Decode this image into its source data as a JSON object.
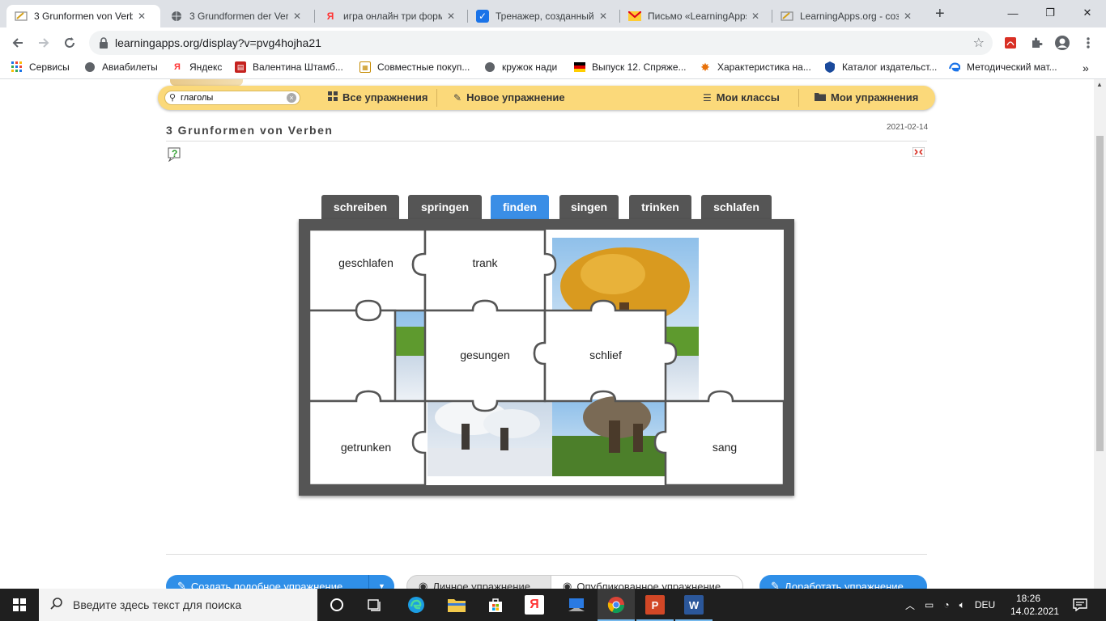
{
  "browser": {
    "tabs": [
      {
        "title": "3 Grunformen von Verb",
        "active": true,
        "icon": "learningapps-icon"
      },
      {
        "title": "3 Grundformen der Ver",
        "active": false,
        "icon": "globe-icon"
      },
      {
        "title": "игра онлайн три форм",
        "active": false,
        "icon": "yandex-icon"
      },
      {
        "title": "Тренажер, созданный",
        "active": false,
        "icon": "check-icon"
      },
      {
        "title": "Письмо «LearningApps",
        "active": false,
        "icon": "mail-icon"
      },
      {
        "title": "LearningApps.org - соз",
        "active": false,
        "icon": "learningapps-icon"
      }
    ],
    "url": "learningapps.org/display?v=pvg4hojha21",
    "bookmarks": [
      {
        "label": "Сервисы",
        "icon": "apps-grid-icon"
      },
      {
        "label": "Авиабилеты",
        "icon": "globe-icon"
      },
      {
        "label": "Яндекс",
        "icon": "yandex-icon"
      },
      {
        "label": "Валентина Штамб...",
        "icon": "book-icon"
      },
      {
        "label": "Совместные покуп...",
        "icon": "calendar-icon"
      },
      {
        "label": "кружок нади",
        "icon": "globe-icon"
      },
      {
        "label": "Выпуск 12. Спряже...",
        "icon": "german-flag-icon"
      },
      {
        "label": "Характеристика на...",
        "icon": "star-icon"
      },
      {
        "label": "Каталог издательст...",
        "icon": "shield-icon"
      },
      {
        "label": "Методический мат...",
        "icon": "edge-icon"
      }
    ]
  },
  "la_nav": {
    "search_value": "глаголы",
    "all_exercises": "Все упражнения",
    "new_exercise": "Новое упражнение",
    "my_classes": "Мои классы",
    "my_exercises": "Мои упражнения"
  },
  "app": {
    "title": "3 Grunformen von Verben",
    "date": "2021-02-14",
    "verb_tabs": [
      {
        "label": "schreiben",
        "selected": false
      },
      {
        "label": "springen",
        "selected": false
      },
      {
        "label": "finden",
        "selected": true
      },
      {
        "label": "singen",
        "selected": false
      },
      {
        "label": "trinken",
        "selected": false
      },
      {
        "label": "schlafen",
        "selected": false
      }
    ],
    "pieces": [
      "geschlafen",
      "trank",
      "gesungen",
      "schlief",
      "getrunken",
      "sang"
    ]
  },
  "bottom_buttons": {
    "create_similar": "Создать подобное упражнение",
    "private": "Личное упражнение",
    "published": "Опубликованное упражнение",
    "improve": "Доработать упражнение"
  },
  "taskbar": {
    "search_placeholder": "Введите здесь текст для поиска",
    "lang": "DEU",
    "time": "18:26",
    "date": "14.02.2021"
  },
  "colors": {
    "accent_blue": "#3a8ee6",
    "nav_yellow": "#fbd97a",
    "frame_grey": "#555555"
  }
}
